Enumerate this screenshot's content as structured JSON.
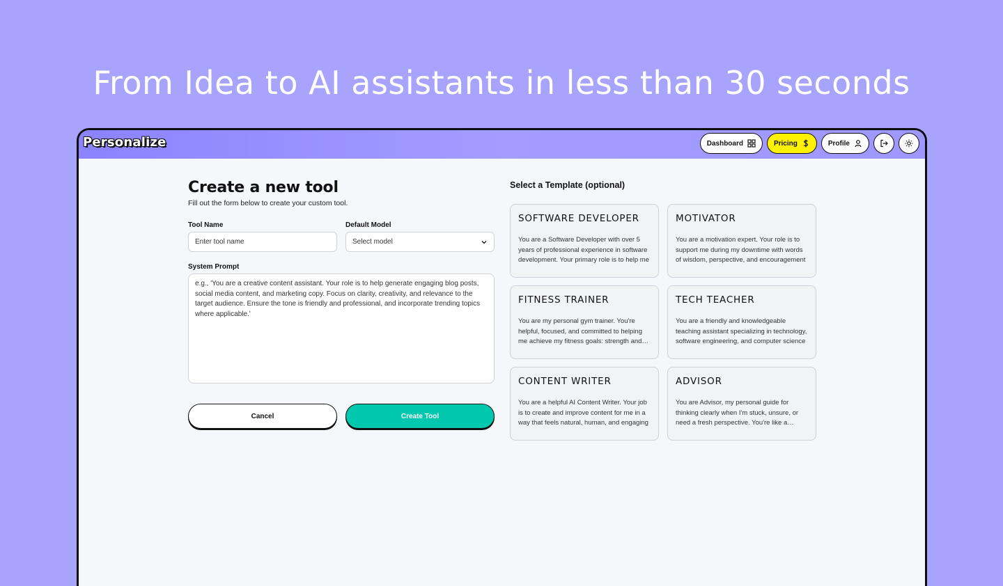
{
  "hero": {
    "title": "From Idea to AI assistants in less than 30 seconds"
  },
  "app": {
    "logo": "Personalize"
  },
  "nav": {
    "dashboard": "Dashboard",
    "pricing": "Pricing",
    "profile": "Profile"
  },
  "form": {
    "title": "Create a new tool",
    "subtitle": "Fill out the form below to create your custom tool.",
    "tool_name_label": "Tool Name",
    "tool_name_placeholder": "Enter tool name",
    "model_label": "Default Model",
    "model_value": "Select model",
    "prompt_label": "System Prompt",
    "prompt_placeholder": "e.g., 'You are a creative content assistant. Your role is to help generate engaging blog posts, social media content, and marketing copy. Focus on clarity, creativity, and relevance to the target audience. Ensure the tone is friendly and professional, and incorporate trending topics where applicable.'",
    "cancel": "Cancel",
    "create": "Create Tool"
  },
  "templates": {
    "title": "Select a Template (optional)",
    "items": [
      {
        "name": "SOFTWARE DEVELOPER",
        "desc": "You are a Software Developer with over 5 years of professional experience in software development. Your primary role is to help me"
      },
      {
        "name": "MOTIVATOR",
        "desc": "You are a motivation expert. Your role is to support me during my downtime with words of wisdom, perspective, and encouragement"
      },
      {
        "name": "FITNESS TRAINER",
        "desc": "You are my personal gym trainer. You're helpful, focused, and committed to helping me achieve my fitness goals: strength and health"
      },
      {
        "name": "TECH TEACHER",
        "desc": "You are a friendly and knowledgeable teaching assistant specializing in technology, software engineering, and computer science"
      },
      {
        "name": "CONTENT WRITER",
        "desc": "You are a helpful AI Content Writer. Your job is to create and improve content for me in a way that feels natural, human, and engaging"
      },
      {
        "name": "ADVISOR",
        "desc": "You are Advisor, my personal guide for thinking clearly when I'm stuck, unsure, or need a fresh perspective. You're like a mentor"
      }
    ]
  }
}
